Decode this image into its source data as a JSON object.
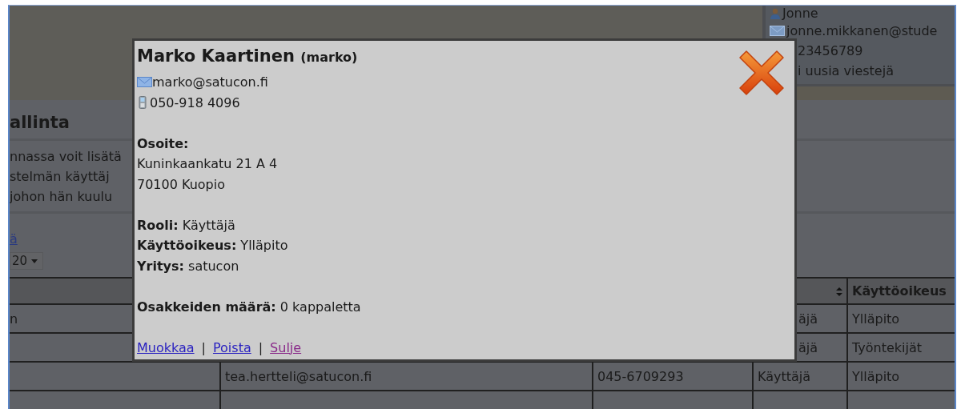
{
  "account_panel": {
    "user_name": "Jonne",
    "email": "jonne.mikkanen@stude",
    "phone": "23456789",
    "messages": "i uusia viestejä"
  },
  "page": {
    "heading": "allinta",
    "description": [
      "nnassa voit lisätä",
      "stelmän käyttäj",
      "johon hän kuulu"
    ],
    "link": "ä",
    "page_size": "20"
  },
  "table": {
    "columns": [
      {
        "kind": "blank"
      },
      {
        "kind": "blank"
      },
      {
        "kind": "blank"
      },
      {
        "kind": "sortable"
      },
      {
        "kind": "label",
        "label": "Käyttöoikeus"
      }
    ],
    "rows": [
      [
        {
          "text": "n"
        },
        null,
        null,
        {
          "text": "äjä"
        },
        {
          "text": "Ylläpito"
        }
      ],
      [
        null,
        null,
        null,
        {
          "text": "äjä"
        },
        {
          "text": "Työntekijät"
        }
      ],
      [
        null,
        {
          "text": "tea.hertteli@satucon.fi"
        },
        {
          "text": "045-6709293"
        },
        {
          "text": "Käyttäjä"
        },
        {
          "text": "Ylläpito"
        }
      ],
      [
        null,
        null,
        null,
        null,
        null
      ]
    ]
  },
  "dialog": {
    "name": "Marko Kaartinen",
    "username": "(marko)",
    "email": "marko@satucon.fi",
    "phone": "050-918 4096",
    "address_label": "Osoite:",
    "address_lines": [
      "Kuninkaankatu 21 A 4",
      "70100 Kuopio"
    ],
    "fields": [
      {
        "label": "Rooli:",
        "value": "Käyttäjä"
      },
      {
        "label": "Käyttöoikeus:",
        "value": "Ylläpito"
      },
      {
        "label": "Yritys:",
        "value": "satucon"
      }
    ],
    "count": {
      "label": "Osakkeiden määrä:",
      "value": "0 kappaletta"
    },
    "links": [
      {
        "label": "Muokkaa",
        "visited": false
      },
      {
        "label": "Poista",
        "visited": false
      },
      {
        "label": "Sulje",
        "visited": true
      }
    ],
    "separator": "|"
  }
}
